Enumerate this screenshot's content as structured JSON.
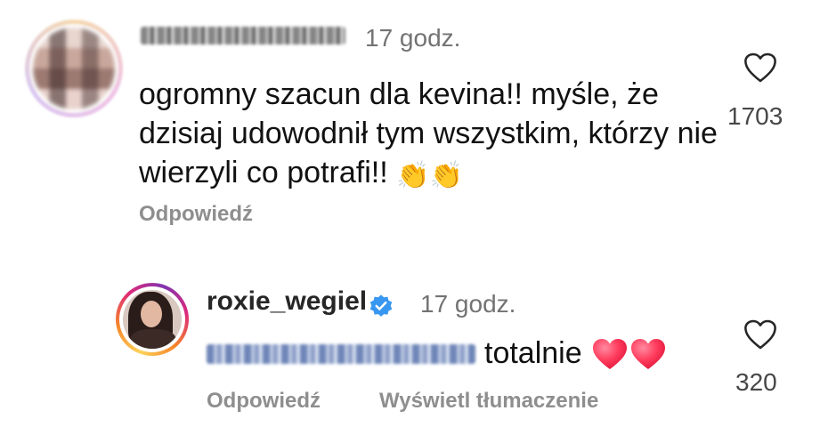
{
  "comment": {
    "username": "roxie_sweetheart",
    "timestamp": "17 godz.",
    "text": "ogromny szacun dla kevina!! myśle, że dzisiaj udowodnił tym wszystkim, którzy nie wierzyli co potrafi!!",
    "emoji": "👏👏",
    "reply_label": "Odpowiedź",
    "like_count": "1703",
    "avatar_icon": "avatar-blurred"
  },
  "reply": {
    "username": "roxie_wegiel",
    "verified_icon": "verified-badge-icon",
    "timestamp": "17 godz.",
    "mention": "@roxie_sweetheart",
    "text": "totalnie",
    "emoji": "❤️❤️",
    "reply_label": "Odpowiedź",
    "translate_label": "Wyświetl tłumaczenie",
    "like_count": "320",
    "avatar_icon": "avatar-story-ring"
  },
  "colors": {
    "text": "#111111",
    "secondary": "#737373",
    "action": "#8e8e8e",
    "verified": "#3897f0",
    "heart": "#ff3b5c"
  }
}
